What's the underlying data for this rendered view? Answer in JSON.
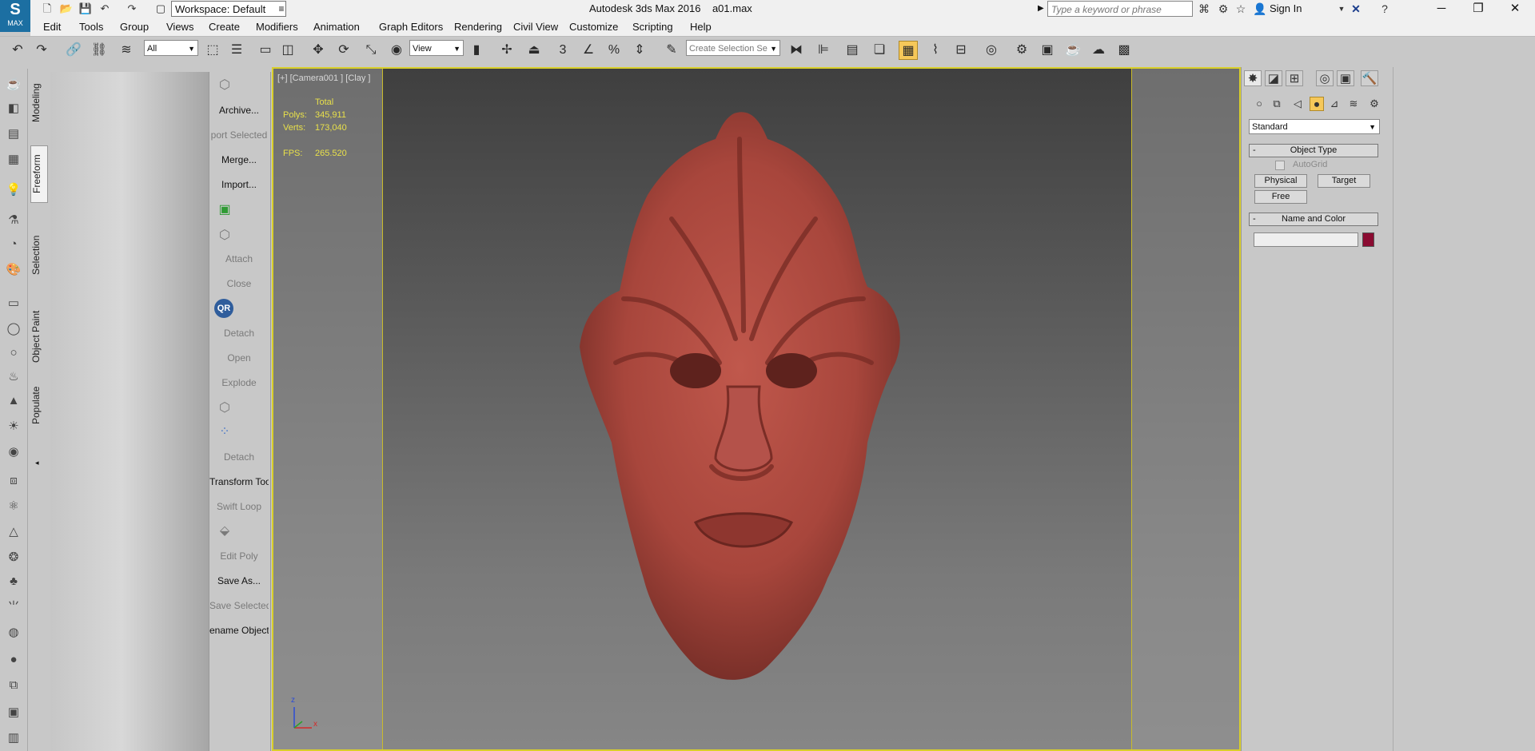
{
  "window": {
    "title": "Autodesk 3ds Max 2016",
    "file": "a01.max",
    "logo_text": "MAX",
    "workspace": "Workspace: Default",
    "search_placeholder": "Type a keyword or phrase",
    "sign_in": "Sign In"
  },
  "menubar": [
    "Edit",
    "Tools",
    "Group",
    "Views",
    "Create",
    "Modifiers",
    "Animation",
    "Graph Editors",
    "Rendering",
    "Civil View",
    "Customize",
    "Scripting",
    "Help"
  ],
  "toolbar": {
    "selection_filter": "All",
    "reference_coord": "View",
    "named_selection_placeholder": "Create Selection Se",
    "snap_number": "3"
  },
  "ribbon_tabs": [
    "Modeling",
    "Freeform",
    "Selection",
    "Object Paint",
    "Populate"
  ],
  "ribbon_active": "Freeform",
  "quad_tools": [
    {
      "label": "Archive...",
      "enabled": true
    },
    {
      "label": "port Selected",
      "enabled": false
    },
    {
      "label": "Merge...",
      "enabled": true
    },
    {
      "label": "Import...",
      "enabled": true
    },
    {
      "label": "Attach",
      "enabled": false
    },
    {
      "label": "Close",
      "enabled": false
    },
    {
      "label": "QR",
      "enabled": true
    },
    {
      "label": "Detach",
      "enabled": false
    },
    {
      "label": "Open",
      "enabled": false
    },
    {
      "label": "Explode",
      "enabled": false
    },
    {
      "label": "Detach",
      "enabled": false
    },
    {
      "label": "Transform Tool",
      "enabled": true
    },
    {
      "label": "Swift Loop",
      "enabled": false
    },
    {
      "label": "Edit Poly",
      "enabled": false
    },
    {
      "label": "Save As...",
      "enabled": true
    },
    {
      "label": "Save Selected",
      "enabled": false
    },
    {
      "label": "ename Objects",
      "enabled": true
    }
  ],
  "viewport": {
    "label": "[+] [Camera001 ] [Clay ]",
    "stats_header": "Total",
    "polys_label": "Polys:",
    "polys": "345,911",
    "verts_label": "Verts:",
    "verts": "173,040",
    "fps_label": "FPS:",
    "fps": "265.520",
    "axis_z": "z",
    "axis_x": "x",
    "model_color": "#a8463c",
    "border_color": "#d9cf2a"
  },
  "command_panel": {
    "dropdown": "Standard",
    "rollout_object_type": "Object Type",
    "autogrid": "AutoGrid",
    "buttons": [
      "Physical",
      "Target",
      "Free"
    ],
    "rollout_name_color": "Name and Color",
    "name_value": "",
    "swatch_color": "#8a0b31"
  }
}
